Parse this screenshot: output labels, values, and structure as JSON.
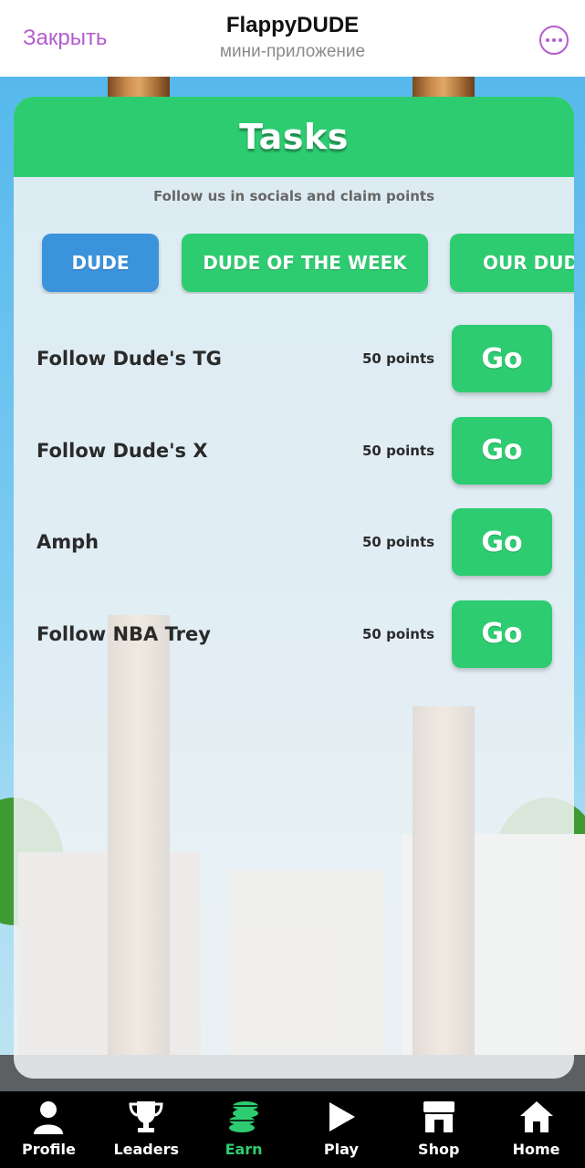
{
  "topbar": {
    "close_label": "Закрыть",
    "app_title": "FlappyDUDE",
    "app_subtitle": "мини-приложение"
  },
  "panel": {
    "title": "Tasks",
    "subtitle": "Follow us in socials and claim points",
    "tabs": [
      {
        "label": "DUDE",
        "active": true
      },
      {
        "label": "DUDE OF THE WEEK",
        "active": false
      },
      {
        "label": "OUR DUDE",
        "active": false
      }
    ],
    "tasks": [
      {
        "name": "Follow Dude's TG",
        "points": "50 points",
        "action": "Go"
      },
      {
        "name": "Follow Dude's X",
        "points": "50 points",
        "action": "Go"
      },
      {
        "name": "Amph",
        "points": "50 points",
        "action": "Go"
      },
      {
        "name": "Follow NBA Trey",
        "points": "50 points",
        "action": "Go"
      }
    ]
  },
  "bottom_nav": {
    "items": [
      {
        "label": "Profile",
        "icon": "user-icon",
        "active": false
      },
      {
        "label": "Leaders",
        "icon": "trophy-icon",
        "active": false
      },
      {
        "label": "Earn",
        "icon": "coins-icon",
        "active": true
      },
      {
        "label": "Play",
        "icon": "play-icon",
        "active": false
      },
      {
        "label": "Shop",
        "icon": "shop-icon",
        "active": false
      },
      {
        "label": "Home",
        "icon": "home-icon",
        "active": false
      }
    ]
  },
  "colors": {
    "accent_green": "#2ecc71",
    "active_tab_blue": "#3b93dc",
    "telegram_link_purple": "#b45ccf"
  }
}
